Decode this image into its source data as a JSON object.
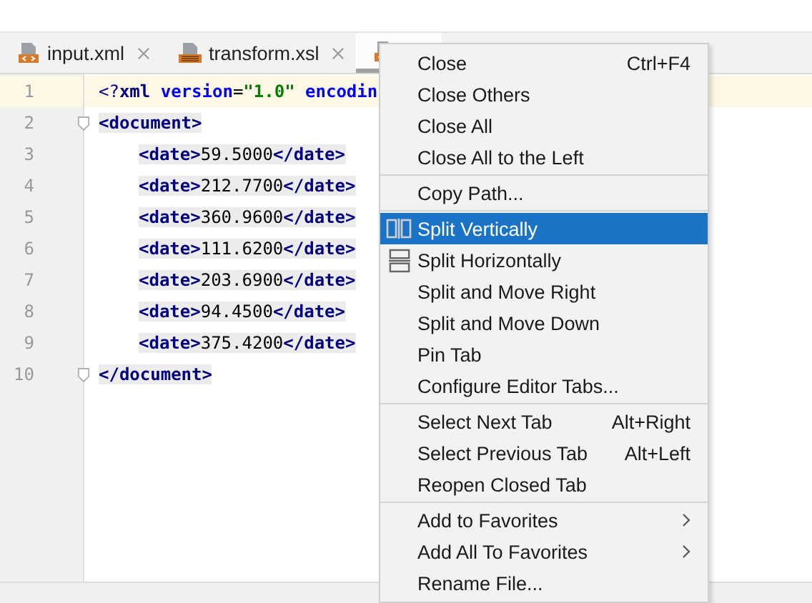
{
  "tabs": [
    {
      "label": "input.xml",
      "kind": "xml",
      "selected": false
    },
    {
      "label": "transform.xsl",
      "kind": "xslt",
      "selected": false
    },
    {
      "kind": "xml",
      "selected": true
    }
  ],
  "editor": {
    "lines": [
      {
        "number": "1",
        "current": true,
        "fold": false,
        "indent": false,
        "tokens": [
          {
            "kind": "decl",
            "text": "<?"
          },
          {
            "kind": "tag",
            "text": "xml "
          },
          {
            "kind": "attr",
            "text": "version"
          },
          {
            "kind": "text",
            "text": "="
          },
          {
            "kind": "value",
            "text": "\"1.0\" "
          },
          {
            "kind": "attr",
            "text": "encodin"
          }
        ]
      },
      {
        "number": "2",
        "current": false,
        "fold": true,
        "indent": false,
        "tokens": [
          {
            "kind": "tag",
            "text": "<document>"
          }
        ]
      },
      {
        "number": "3",
        "current": false,
        "fold": false,
        "indent": true,
        "tokens": [
          {
            "kind": "tag",
            "text": "<date>"
          },
          {
            "kind": "text",
            "text": "59.5000"
          },
          {
            "kind": "tag",
            "text": "</date>"
          }
        ]
      },
      {
        "number": "4",
        "current": false,
        "fold": false,
        "indent": true,
        "tokens": [
          {
            "kind": "tag",
            "text": "<date>"
          },
          {
            "kind": "text",
            "text": "212.7700"
          },
          {
            "kind": "tag",
            "text": "</date>"
          }
        ]
      },
      {
        "number": "5",
        "current": false,
        "fold": false,
        "indent": true,
        "tokens": [
          {
            "kind": "tag",
            "text": "<date>"
          },
          {
            "kind": "text",
            "text": "360.9600"
          },
          {
            "kind": "tag",
            "text": "</date>"
          }
        ]
      },
      {
        "number": "6",
        "current": false,
        "fold": false,
        "indent": true,
        "tokens": [
          {
            "kind": "tag",
            "text": "<date>"
          },
          {
            "kind": "text",
            "text": "111.6200"
          },
          {
            "kind": "tag",
            "text": "</date>"
          }
        ]
      },
      {
        "number": "7",
        "current": false,
        "fold": false,
        "indent": true,
        "tokens": [
          {
            "kind": "tag",
            "text": "<date>"
          },
          {
            "kind": "text",
            "text": "203.6900"
          },
          {
            "kind": "tag",
            "text": "</date>"
          }
        ]
      },
      {
        "number": "8",
        "current": false,
        "fold": false,
        "indent": true,
        "tokens": [
          {
            "kind": "tag",
            "text": "<date>"
          },
          {
            "kind": "text",
            "text": "94.4500"
          },
          {
            "kind": "tag",
            "text": "</date>"
          }
        ]
      },
      {
        "number": "9",
        "current": false,
        "fold": false,
        "indent": true,
        "tokens": [
          {
            "kind": "tag",
            "text": "<date>"
          },
          {
            "kind": "text",
            "text": "375.4200"
          },
          {
            "kind": "tag",
            "text": "</date>"
          }
        ]
      },
      {
        "number": "10",
        "current": false,
        "fold": true,
        "indent": false,
        "tokens": [
          {
            "kind": "tag",
            "text": "</document>"
          }
        ]
      }
    ]
  },
  "context_menu": {
    "items": [
      {
        "kind": "item",
        "label": "Close",
        "shortcut": "Ctrl+F4",
        "selected": false
      },
      {
        "kind": "item",
        "label": "Close Others",
        "selected": false
      },
      {
        "kind": "item",
        "label": "Close All",
        "selected": false
      },
      {
        "kind": "item",
        "label": "Close All to the Left",
        "selected": false
      },
      {
        "kind": "separator"
      },
      {
        "kind": "item",
        "label": "Copy Path...",
        "selected": false
      },
      {
        "kind": "separator"
      },
      {
        "kind": "vsplit",
        "label": "Split Vertically",
        "selected": true
      },
      {
        "kind": "hsplit",
        "label": "Split Horizontally",
        "selected": false
      },
      {
        "kind": "item",
        "label": "Split and Move Right",
        "selected": false
      },
      {
        "kind": "item",
        "label": "Split and Move Down",
        "selected": false
      },
      {
        "kind": "item",
        "label": "Pin Tab",
        "selected": false
      },
      {
        "kind": "item",
        "label": "Configure Editor Tabs...",
        "selected": false
      },
      {
        "kind": "separator"
      },
      {
        "kind": "item",
        "label": "Select Next Tab",
        "shortcut": "Alt+Right",
        "selected": false
      },
      {
        "kind": "item",
        "label": "Select Previous Tab",
        "shortcut": "Alt+Left",
        "selected": false
      },
      {
        "kind": "item",
        "label": "Reopen Closed Tab",
        "selected": false
      },
      {
        "kind": "separator"
      },
      {
        "kind": "item",
        "label": "Add to Favorites",
        "submenu": true,
        "selected": false
      },
      {
        "kind": "item",
        "label": "Add All To Favorites",
        "submenu": true,
        "selected": false
      },
      {
        "kind": "item",
        "label": "Rename File...",
        "selected": false
      }
    ]
  }
}
